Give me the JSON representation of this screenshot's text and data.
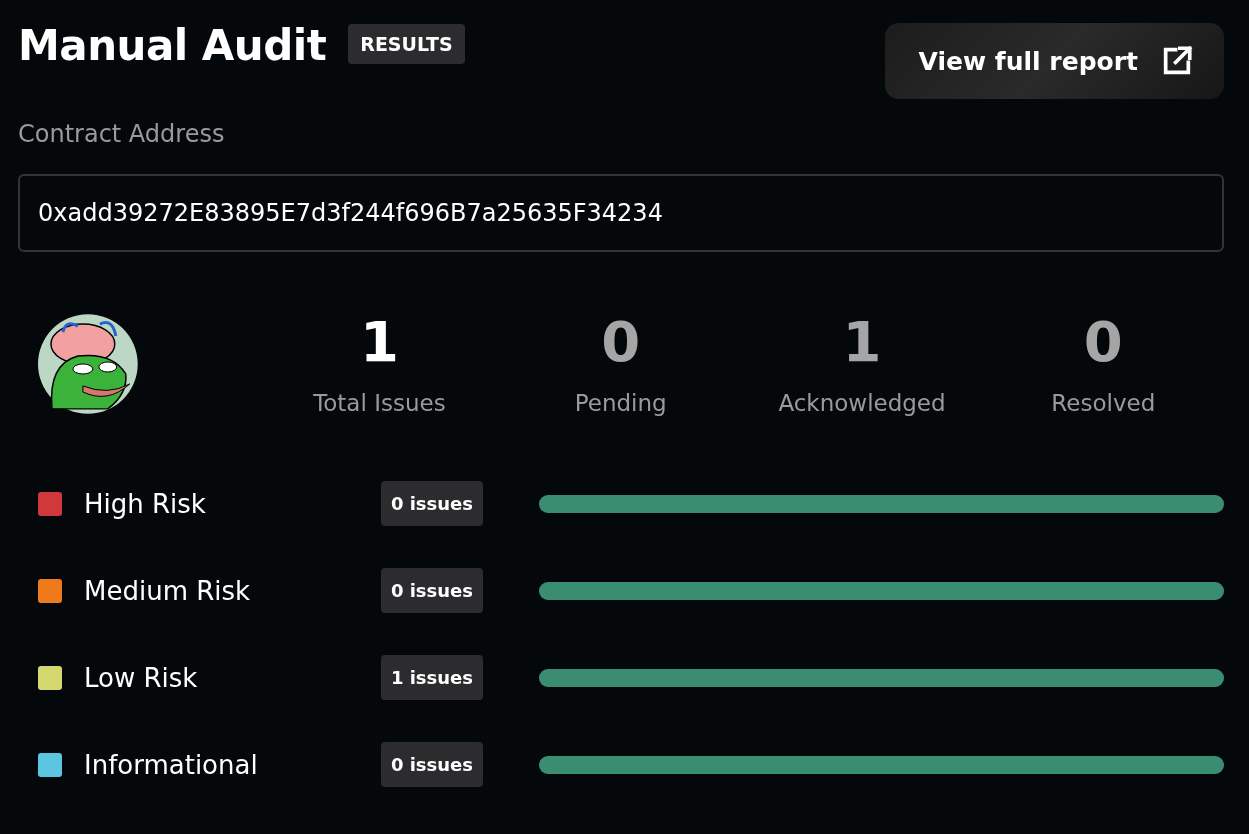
{
  "header": {
    "title": "Manual Audit",
    "badge": "RESULTS",
    "button": "View full report"
  },
  "contract": {
    "label": "Contract Address",
    "value": "0xadd39272E83895E7d3f244f696B7a25635F34234"
  },
  "stats": [
    {
      "value": "1",
      "label": "Total Issues",
      "emphasized": true
    },
    {
      "value": "0",
      "label": "Pending",
      "emphasized": false
    },
    {
      "value": "1",
      "label": "Acknowledged",
      "emphasized": false
    },
    {
      "value": "0",
      "label": "Resolved",
      "emphasized": false
    }
  ],
  "risks": [
    {
      "name": "High Risk",
      "color": "#d0393c",
      "count": "0 issues",
      "level": 1
    },
    {
      "name": "Medium Risk",
      "color": "#ee7a1a",
      "count": "0 issues",
      "level": 1
    },
    {
      "name": "Low Risk",
      "color": "#d5d870",
      "count": "1 issues",
      "level": 1
    },
    {
      "name": "Informational",
      "color": "#5cc6e0",
      "count": "0 issues",
      "level": 1
    }
  ]
}
